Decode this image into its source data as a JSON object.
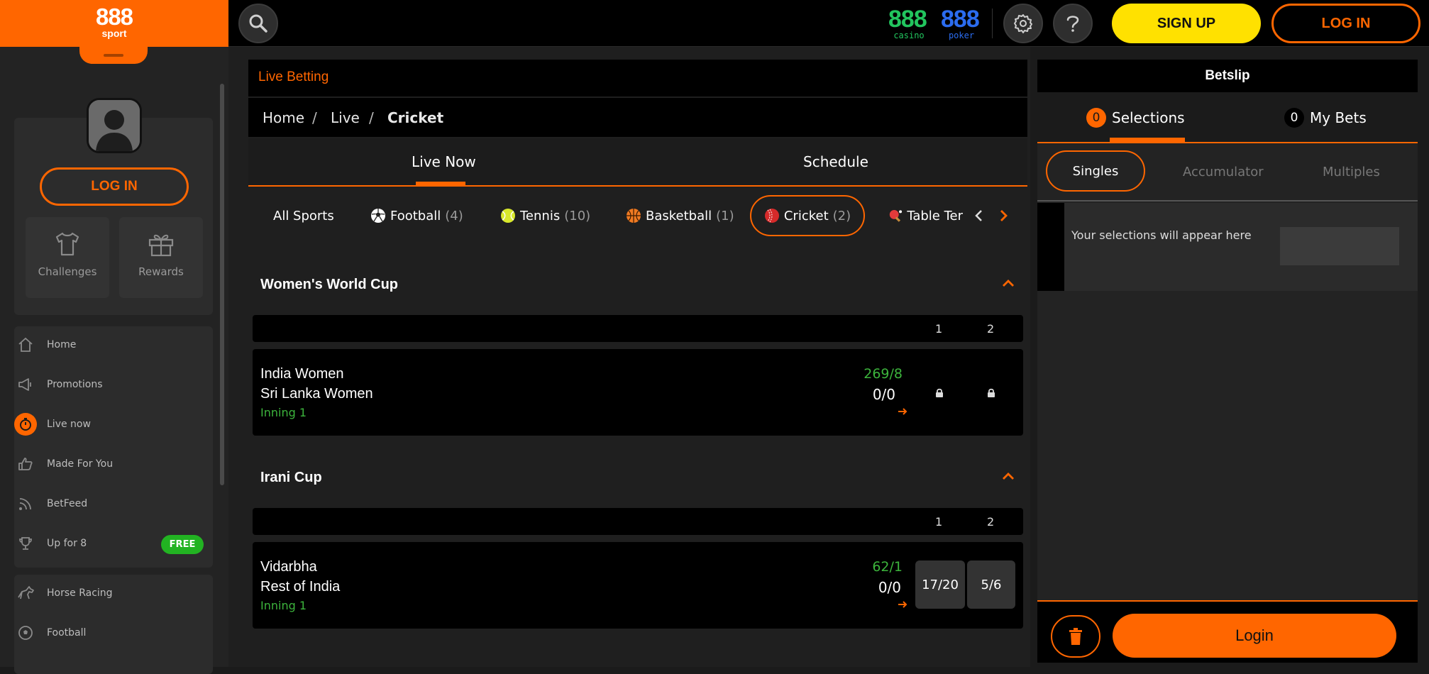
{
  "logo": {
    "name": "888",
    "sub": "sport"
  },
  "header": {
    "casino_num": "888",
    "casino_label": "casino",
    "poker_num": "888",
    "poker_label": "poker",
    "signup_label": "SIGN UP",
    "login_label": "LOG IN"
  },
  "sidebar": {
    "login_label": "LOG IN",
    "tiles": [
      {
        "label": "Challenges"
      },
      {
        "label": "Rewards"
      }
    ],
    "nav": [
      {
        "label": "Home"
      },
      {
        "label": "Promotions"
      },
      {
        "label": "Live now"
      },
      {
        "label": "Made For You"
      },
      {
        "label": "BetFeed"
      },
      {
        "label": "Up for 8",
        "badge": "FREE"
      }
    ],
    "nav2": [
      {
        "label": "Horse Racing"
      },
      {
        "label": "Football"
      }
    ]
  },
  "main": {
    "section_title": "Live Betting",
    "breadcrumb": [
      "Home",
      "Live",
      "Cricket"
    ],
    "tabs": [
      "Live Now",
      "Schedule"
    ],
    "sports": [
      {
        "label": "All Sports",
        "count": ""
      },
      {
        "label": "Football",
        "count": "(4)"
      },
      {
        "label": "Tennis",
        "count": "(10)"
      },
      {
        "label": "Basketball",
        "count": "(1)"
      },
      {
        "label": "Cricket",
        "count": "(2)"
      },
      {
        "label": "Table Ter",
        "count": ""
      }
    ],
    "competitions": [
      {
        "name": "Women's World Cup",
        "col1": "1",
        "col2": "2",
        "home": "India Women",
        "away": "Sri Lanka Women",
        "home_score": "269/8",
        "away_score": "0/0",
        "status": "Inning 1",
        "odds": []
      },
      {
        "name": "Irani Cup",
        "col1": "1",
        "col2": "2",
        "home": "Vidarbha",
        "away": "Rest of India",
        "home_score": "62/1",
        "away_score": "0/0",
        "status": "Inning 1",
        "odds": [
          "17/20",
          "5/6"
        ]
      }
    ]
  },
  "betslip": {
    "title": "Betslip",
    "selections_count": "0",
    "selections_label": "Selections",
    "mybets_count": "0",
    "mybets_label": "My Bets",
    "types": [
      "Singles",
      "Accumulator",
      "Multiples"
    ],
    "empty_text": "Your selections will appear here",
    "login_label": "Login"
  },
  "colors": {
    "accent": "#ff6600",
    "signup": "#ffe100",
    "live_green": "#3cb43c",
    "casino": "#22c55e",
    "poker": "#2b6cf0"
  }
}
